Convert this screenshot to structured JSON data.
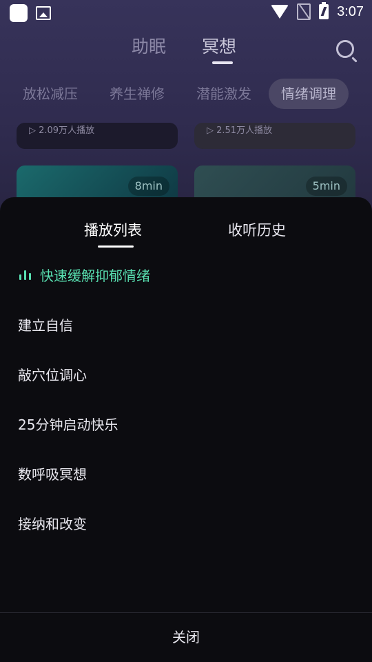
{
  "status_bar": {
    "time": "3:07"
  },
  "top_tabs": {
    "sleep": "助眠",
    "meditate": "冥想"
  },
  "categories": [
    "放松减压",
    "养生禅修",
    "潜能激发",
    "情绪调理"
  ],
  "cards": [
    {
      "plays": "▷ 2.09万人播放"
    },
    {
      "plays": "▷ 2.51万人播放"
    },
    {
      "duration": "8min"
    },
    {
      "duration": "5min"
    }
  ],
  "sheet": {
    "tabs": {
      "playlist": "播放列表",
      "history": "收听历史"
    },
    "items": [
      "快速缓解抑郁情绪",
      "建立自信",
      "敲穴位调心",
      "25分钟启动快乐",
      "数呼吸冥想",
      "接纳和改变"
    ],
    "close": "关闭"
  },
  "colors": {
    "accent": "#58dfb0",
    "sheet_bg": "#0c0c10"
  }
}
